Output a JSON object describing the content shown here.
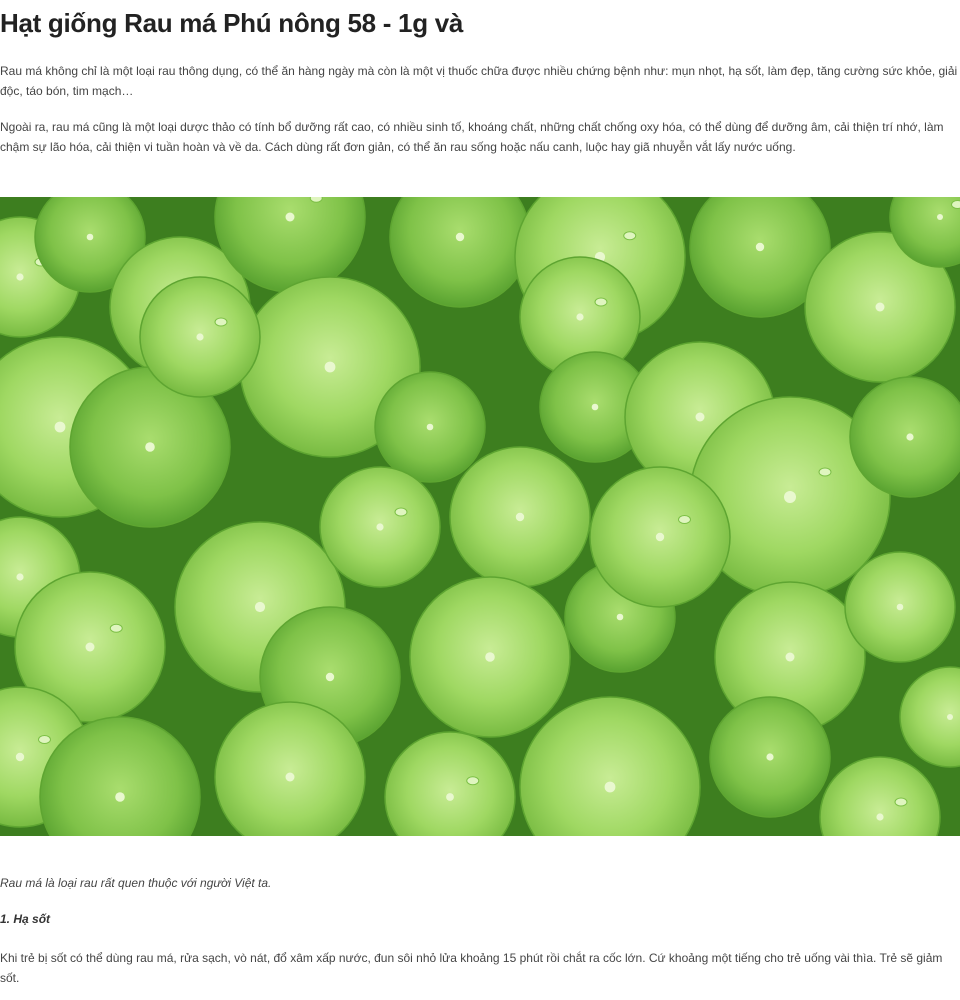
{
  "article": {
    "title": "Hạt giống Rau má Phú nông 58 - 1g và",
    "intro_paragraph": "Rau má không chỉ là một loại rau thông dụng, có thể ăn hàng ngày mà còn là một vị thuốc chữa được nhiều chứng bệnh như: mụn nhọt, hạ sốt, làm đẹp, tăng cường sức khỏe, giải độc, táo bón, tim mạch…",
    "second_paragraph": "Ngoài ra, rau má cũng là một loại dược thảo có tính bổ dưỡng rất cao, có nhiều sinh tố, khoáng chất, những chất chống oxy hóa, có thể dùng để dưỡng âm, cải thiện trí nhớ, làm chậm sự lão hóa, cải thiện vi tuần hoàn và về da. Cách dùng rất đơn giản, có thể ăn rau sống hoặc nấu canh, luộc hay giã nhuyễn vắt lấy nước uống.",
    "image_caption": "Rau má là loại rau rất quen thuộc với người Việt ta.",
    "section_heading": "1. Hạ sốt",
    "section_paragraph": "Khi trẻ bị sốt có thể dùng rau má, rửa sạch, vò nát, đổ xâm xấp nước, đun sôi nhỏ lửa khoảng 15 phút rồi chắt ra cốc lớn. Cứ khoảng một tiếng cho trẻ uống vài thìa. Trẻ sẽ giảm sốt."
  },
  "colors": {
    "leaf_light": "#b5e27a",
    "leaf_mid": "#8ccf52",
    "leaf_dark": "#4f9a2a",
    "background_shadow": "#2f6b18"
  }
}
